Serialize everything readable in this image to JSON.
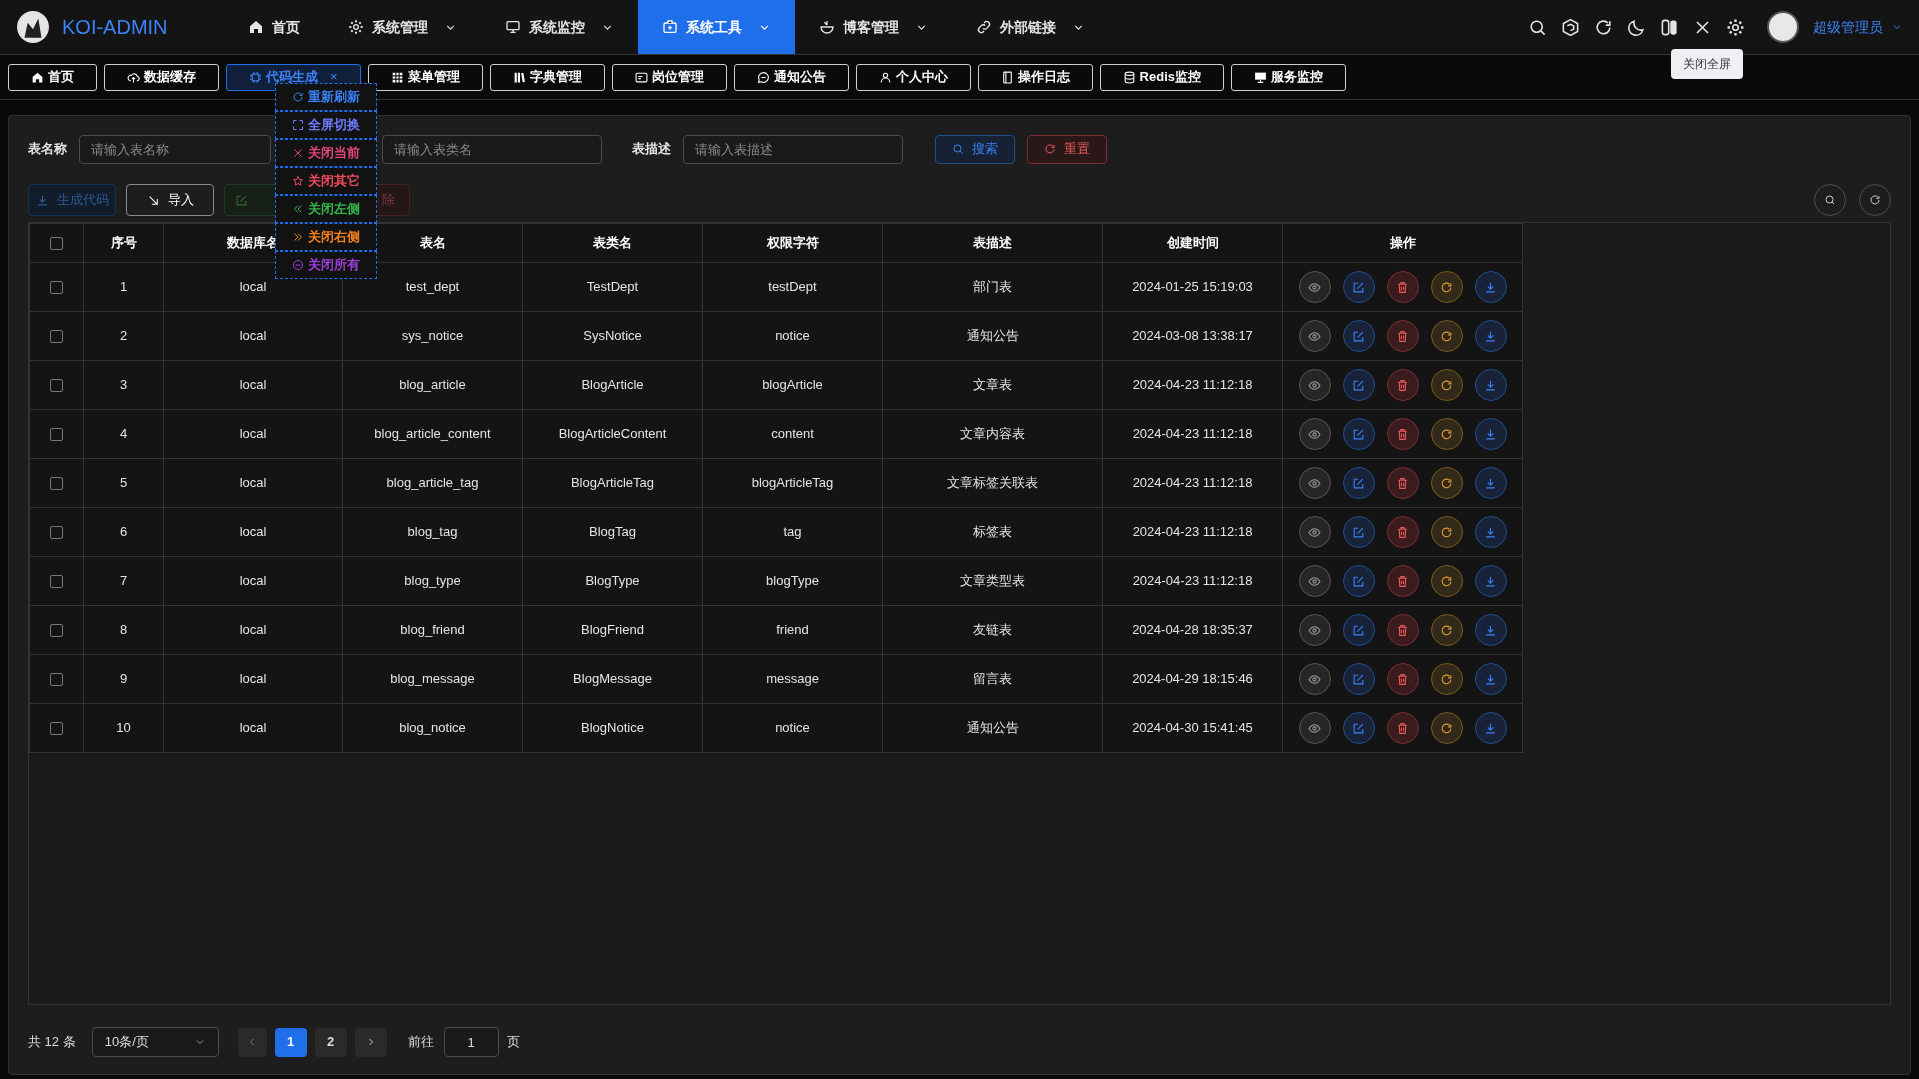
{
  "brand": {
    "title": "KOI-ADMIN"
  },
  "nav": [
    {
      "label": "首页",
      "kind": "home",
      "selected": false,
      "dropdown": false
    },
    {
      "label": "系统管理",
      "kind": "gear",
      "selected": false,
      "dropdown": true
    },
    {
      "label": "系统监控",
      "kind": "monitor",
      "selected": false,
      "dropdown": true
    },
    {
      "label": "系统工具",
      "kind": "toolbox",
      "selected": true,
      "dropdown": true
    },
    {
      "label": "博客管理",
      "kind": "bowl",
      "selected": false,
      "dropdown": true
    },
    {
      "label": "外部链接",
      "kind": "link",
      "selected": false,
      "dropdown": true
    }
  ],
  "user": {
    "name": "超级管理员"
  },
  "tooltip": {
    "text": "关闭全屏"
  },
  "tabs": [
    {
      "label": "首页",
      "kind": "home",
      "selected": false
    },
    {
      "label": "数据缓存",
      "kind": "cloud",
      "selected": false
    },
    {
      "label": "代码生成",
      "kind": "chip",
      "selected": true,
      "close": "×"
    },
    {
      "label": "菜单管理",
      "kind": "grid",
      "selected": false
    },
    {
      "label": "字典管理",
      "kind": "books",
      "selected": false
    },
    {
      "label": "岗位管理",
      "kind": "card",
      "selected": false
    },
    {
      "label": "通知公告",
      "kind": "chat",
      "selected": false
    },
    {
      "label": "个人中心",
      "kind": "user",
      "selected": false
    },
    {
      "label": "操作日志",
      "kind": "log",
      "selected": false
    },
    {
      "label": "Redis监控",
      "kind": "db",
      "selected": false
    },
    {
      "label": "服务监控",
      "kind": "screen",
      "selected": false
    }
  ],
  "context_menu": [
    {
      "label": "重新刷新",
      "kind": "refresh",
      "color": "#3b82f6"
    },
    {
      "label": "全屏切换",
      "kind": "expand",
      "color": "#6f7cff"
    },
    {
      "label": "关闭当前",
      "kind": "x",
      "color": "#e0457b"
    },
    {
      "label": "关闭其它",
      "kind": "star",
      "color": "#f0485a"
    },
    {
      "label": "关闭左侧",
      "kind": "left",
      "color": "#35b44a"
    },
    {
      "label": "关闭右侧",
      "kind": "right",
      "color": "#f5801f"
    },
    {
      "label": "关闭所有",
      "kind": "minus",
      "color": "#9b3fd8"
    }
  ],
  "search_form": [
    {
      "label": "表名称",
      "placeholder": "请输入表名称"
    },
    {
      "placeholder": "请输入表类名"
    },
    {
      "label": "表描述",
      "placeholder": "请输入表描述"
    }
  ],
  "search_buttons": [
    {
      "label": "搜索",
      "kind": "search"
    },
    {
      "label": "重置",
      "kind": "reset"
    }
  ],
  "toolbar": [
    {
      "label": "生成代码",
      "kind": "generate",
      "disabled": true
    },
    {
      "label": "导入",
      "kind": "import",
      "disabled": false
    },
    {
      "kind": "edit",
      "disabled": true
    },
    {
      "label": "除",
      "kind": "delete",
      "disabled": true
    }
  ],
  "table": {
    "all_checked": false,
    "columns": [
      "序号",
      "数据库名",
      "表名",
      "表类名",
      "权限字符",
      "表描述",
      "创建时间",
      "操作"
    ],
    "rows": [
      {
        "checked": false,
        "cells": [
          "1",
          "local",
          "test_dept",
          "TestDept",
          "testDept",
          "部门表",
          "2024-01-25 15:19:03"
        ]
      },
      {
        "checked": false,
        "cells": [
          "2",
          "local",
          "sys_notice",
          "SysNotice",
          "notice",
          "通知公告",
          "2024-03-08 13:38:17"
        ]
      },
      {
        "checked": false,
        "cells": [
          "3",
          "local",
          "blog_article",
          "BlogArticle",
          "blogArticle",
          "文章表",
          "2024-04-23 11:12:18"
        ]
      },
      {
        "checked": false,
        "cells": [
          "4",
          "local",
          "blog_article_content",
          "BlogArticleContent",
          "content",
          "文章内容表",
          "2024-04-23 11:12:18"
        ]
      },
      {
        "checked": false,
        "cells": [
          "5",
          "local",
          "blog_article_tag",
          "BlogArticleTag",
          "blogArticleTag",
          "文章标签关联表",
          "2024-04-23 11:12:18"
        ]
      },
      {
        "checked": false,
        "cells": [
          "6",
          "local",
          "blog_tag",
          "BlogTag",
          "tag",
          "标签表",
          "2024-04-23 11:12:18"
        ]
      },
      {
        "checked": false,
        "cells": [
          "7",
          "local",
          "blog_type",
          "BlogType",
          "blogType",
          "文章类型表",
          "2024-04-23 11:12:18"
        ]
      },
      {
        "checked": false,
        "cells": [
          "8",
          "local",
          "blog_friend",
          "BlogFriend",
          "friend",
          "友链表",
          "2024-04-28 18:35:37"
        ]
      },
      {
        "checked": false,
        "cells": [
          "9",
          "local",
          "blog_message",
          "BlogMessage",
          "message",
          "留言表",
          "2024-04-29 18:15:46"
        ]
      },
      {
        "checked": false,
        "cells": [
          "10",
          "local",
          "blog_notice",
          "BlogNotice",
          "notice",
          "通知公告",
          "2024-04-30 15:41:45"
        ]
      }
    ]
  },
  "pagination": {
    "total": "共 12 条",
    "page_size": "10条/页",
    "pages": [
      {
        "label": "1",
        "selected": true
      },
      {
        "label": "2",
        "selected": false
      }
    ],
    "goto_label": "前往",
    "goto_value": "1",
    "goto_suffix": "页"
  }
}
